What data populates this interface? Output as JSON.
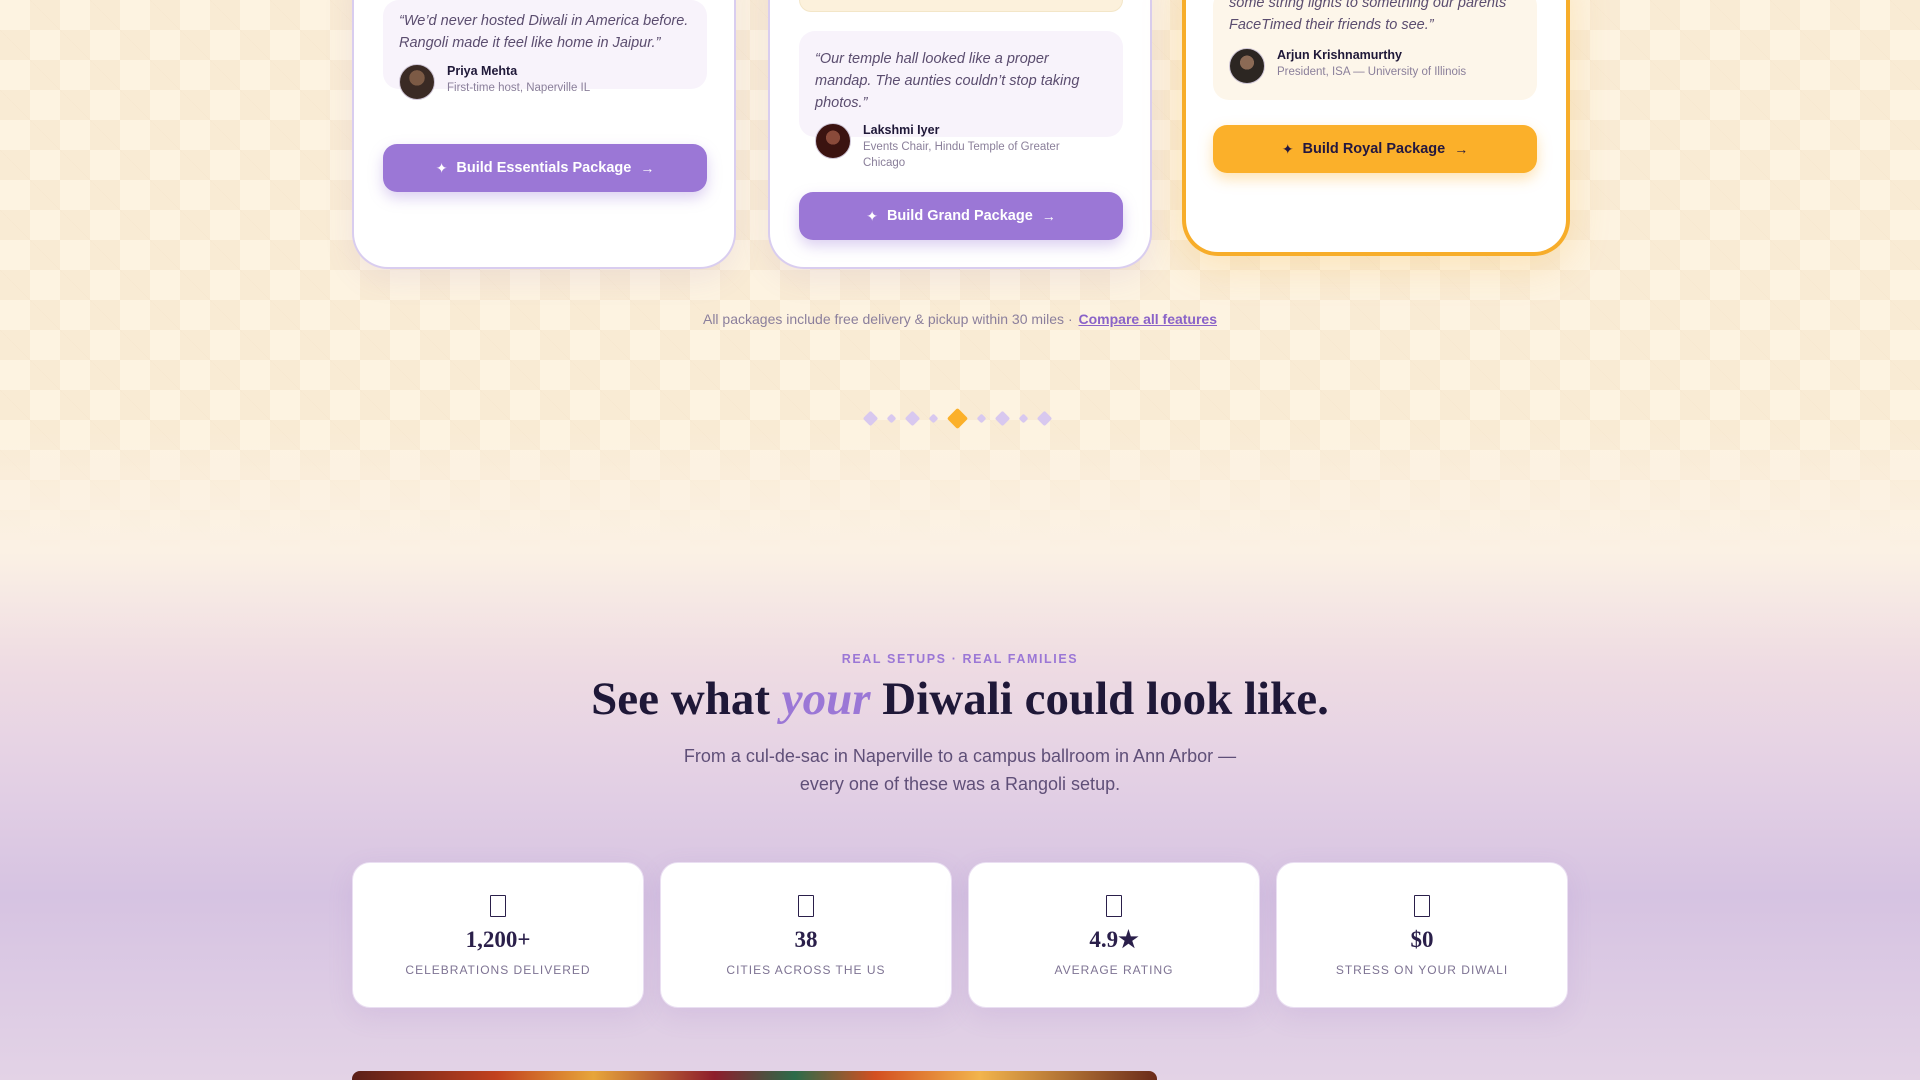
{
  "packages": [
    {
      "name": "Essentials",
      "quote": "“We’d never hosted Diwali in America before. Rangoli made it feel like home in Jaipur.”",
      "author": "Priya Mehta",
      "role": "First-time host, Naperville IL",
      "button_label": "Build Essentials Package"
    },
    {
      "name": "Grand",
      "quote": "“Our temple hall looked like a proper mandap. The aunties couldn’t stop taking photos.”",
      "author": "Lakshmi Iyer",
      "role": "Events Chair, Hindu Temple of Greater Chicago",
      "button_label": "Build Grand Package"
    },
    {
      "name": "Royal",
      "quote": "some string lights to something our parents FaceTimed their friends to see.”",
      "author": "Arjun Krishnamurthy",
      "role": "President, ISA — University of Illinois",
      "button_label": "Build Royal Package"
    }
  ],
  "packages_note": {
    "text": "All packages include free delivery & pickup within 30 miles · ",
    "link": "Compare all features"
  },
  "carousel": {
    "total": 9,
    "active_index": 4
  },
  "gallery": {
    "eyebrow": "REAL SETUPS · REAL FAMILIES",
    "headline_pre": "See what ",
    "headline_em": "your",
    "headline_post": " Diwali could look like.",
    "subline_1": "From a cul-de-sac in Naperville to a campus ballroom in Ann Arbor —",
    "subline_2": "every one of these was a Rangoli setup."
  },
  "stats": [
    {
      "icon": "box-icon",
      "value": "1,200+",
      "label": "CELEBRATIONS DELIVERED"
    },
    {
      "icon": "box-icon",
      "value": "38",
      "label": "CITIES ACROSS THE US"
    },
    {
      "icon": "box-icon",
      "value": "4.9★",
      "label": "AVERAGE RATING"
    },
    {
      "icon": "box-icon",
      "value": "$0",
      "label": "STRESS ON YOUR DIWALI"
    }
  ],
  "colors": {
    "accent_purple": "#9b77d6",
    "accent_gold": "#fbb02a",
    "ink": "#1f1838",
    "cream": "#fdf3e1"
  }
}
